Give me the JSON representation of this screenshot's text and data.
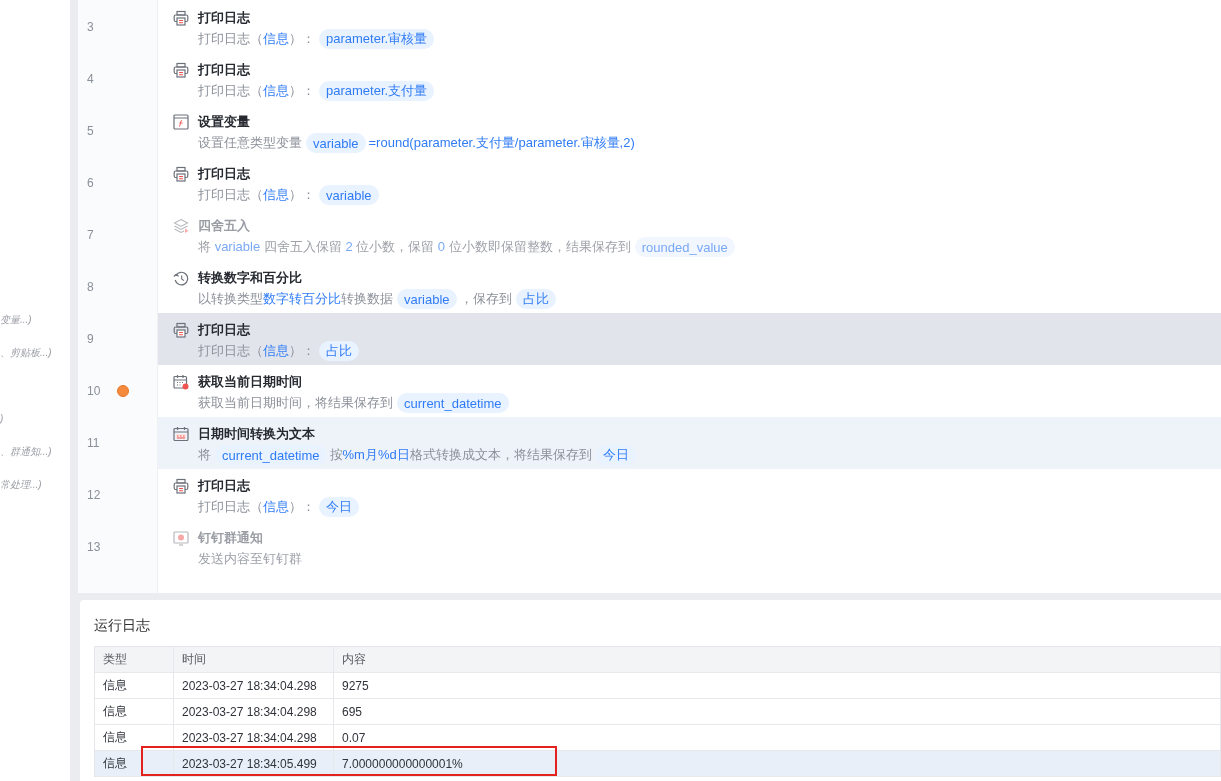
{
  "sidebar": {
    "hints": [
      "变量...)",
      "、剪贴板...)",
      ")",
      "、群通知...)",
      "常处理...)"
    ]
  },
  "steps": [
    {
      "number": "3",
      "kind": "print_log",
      "title": "打印日志",
      "description": [
        {
          "kind": "text",
          "text": "打印日志（"
        },
        {
          "kind": "value",
          "text": "信息"
        },
        {
          "kind": "text",
          "text": "）："
        },
        {
          "kind": "tag",
          "text": "parameter.审核量"
        }
      ],
      "selected": false,
      "hovered": false,
      "disabled": false,
      "breakpoint": false
    },
    {
      "number": "4",
      "kind": "print_log",
      "title": "打印日志",
      "description": [
        {
          "kind": "text",
          "text": "打印日志（"
        },
        {
          "kind": "value",
          "text": "信息"
        },
        {
          "kind": "text",
          "text": "）："
        },
        {
          "kind": "tag",
          "text": "parameter.支付量"
        }
      ],
      "selected": false,
      "hovered": false,
      "disabled": false,
      "breakpoint": false
    },
    {
      "number": "5",
      "kind": "set_variable",
      "title": "设置变量",
      "description": [
        {
          "kind": "text",
          "text": "设置任意类型变量"
        },
        {
          "kind": "tag",
          "text": "variable"
        },
        {
          "kind": "value",
          "text": "=round(parameter.支付量/parameter.审核量,2)"
        }
      ],
      "selected": false,
      "hovered": false,
      "disabled": false,
      "breakpoint": false
    },
    {
      "number": "6",
      "kind": "print_log",
      "title": "打印日志",
      "description": [
        {
          "kind": "text",
          "text": "打印日志（"
        },
        {
          "kind": "value",
          "text": "信息"
        },
        {
          "kind": "text",
          "text": "）："
        },
        {
          "kind": "tag",
          "text": "variable"
        }
      ],
      "selected": false,
      "hovered": false,
      "disabled": false,
      "breakpoint": false
    },
    {
      "number": "7",
      "kind": "round_number",
      "title": "四舍五入",
      "description": [
        {
          "kind": "text",
          "text": "将 "
        },
        {
          "kind": "value",
          "text": "variable"
        },
        {
          "kind": "text",
          "text": " 四舍五入保留 "
        },
        {
          "kind": "value",
          "text": "2"
        },
        {
          "kind": "text",
          "text": " 位小数，保留 "
        },
        {
          "kind": "value",
          "text": "0"
        },
        {
          "kind": "text",
          "text": " 位小数即保留整数，结果保存到"
        },
        {
          "kind": "tag",
          "text": "rounded_value"
        }
      ],
      "selected": false,
      "hovered": false,
      "disabled": true,
      "breakpoint": false
    },
    {
      "number": "8",
      "kind": "convert_number",
      "title": "转换数字和百分比",
      "description": [
        {
          "kind": "text",
          "text": "以转换类型"
        },
        {
          "kind": "value",
          "text": "数字转百分比"
        },
        {
          "kind": "text",
          "text": "转换数据"
        },
        {
          "kind": "tag",
          "text": "variable"
        },
        {
          "kind": "text",
          "text": "，保存到"
        },
        {
          "kind": "tag",
          "text": "占比"
        }
      ],
      "selected": false,
      "hovered": false,
      "disabled": false,
      "breakpoint": false
    },
    {
      "number": "9",
      "kind": "print_log",
      "title": "打印日志",
      "description": [
        {
          "kind": "text",
          "text": "打印日志（"
        },
        {
          "kind": "value",
          "text": "信息"
        },
        {
          "kind": "text",
          "text": "）："
        },
        {
          "kind": "tag",
          "text": "占比"
        }
      ],
      "selected": true,
      "hovered": false,
      "disabled": false,
      "breakpoint": false
    },
    {
      "number": "10",
      "kind": "get_datetime",
      "title": "获取当前日期时间",
      "description": [
        {
          "kind": "text",
          "text": "获取当前日期时间，将结果保存到"
        },
        {
          "kind": "tag",
          "text": "current_datetime"
        }
      ],
      "selected": false,
      "hovered": false,
      "disabled": false,
      "breakpoint": true
    },
    {
      "number": "11",
      "kind": "datetime_to_text",
      "title": "日期时间转换为文本",
      "description": [
        {
          "kind": "text",
          "text": "将"
        },
        {
          "kind": "tag",
          "text": "current_datetime"
        },
        {
          "kind": "text",
          "text": "按"
        },
        {
          "kind": "value",
          "text": "%m月%d日"
        },
        {
          "kind": "text",
          "text": "格式转换成文本，将结果保存到"
        },
        {
          "kind": "tag",
          "text": "今日"
        }
      ],
      "selected": false,
      "hovered": true,
      "disabled": false,
      "breakpoint": false
    },
    {
      "number": "12",
      "kind": "print_log",
      "title": "打印日志",
      "description": [
        {
          "kind": "text",
          "text": "打印日志（"
        },
        {
          "kind": "value",
          "text": "信息"
        },
        {
          "kind": "text",
          "text": "）："
        },
        {
          "kind": "tag",
          "text": "今日"
        }
      ],
      "selected": false,
      "hovered": false,
      "disabled": false,
      "breakpoint": false
    },
    {
      "number": "13",
      "kind": "dingtalk_notice",
      "title": "钉钉群通知",
      "description": [
        {
          "kind": "text",
          "text": "发送内容至钉钉群"
        }
      ],
      "selected": false,
      "hovered": false,
      "disabled": true,
      "breakpoint": false
    }
  ],
  "log_panel": {
    "title": "运行日志",
    "columns": [
      "类型",
      "时间",
      "内容"
    ],
    "rows": [
      {
        "type": "信息",
        "time": "2023-03-27 18:34:04.298",
        "content": "9275",
        "selected": false,
        "marked": false
      },
      {
        "type": "信息",
        "time": "2023-03-27 18:34:04.298",
        "content": "695",
        "selected": false,
        "marked": false
      },
      {
        "type": "信息",
        "time": "2023-03-27 18:34:04.298",
        "content": "0.07",
        "selected": false,
        "marked": false
      },
      {
        "type": "信息",
        "time": "2023-03-27 18:34:05.499",
        "content": "7.000000000000001%",
        "selected": true,
        "marked": true
      }
    ]
  }
}
